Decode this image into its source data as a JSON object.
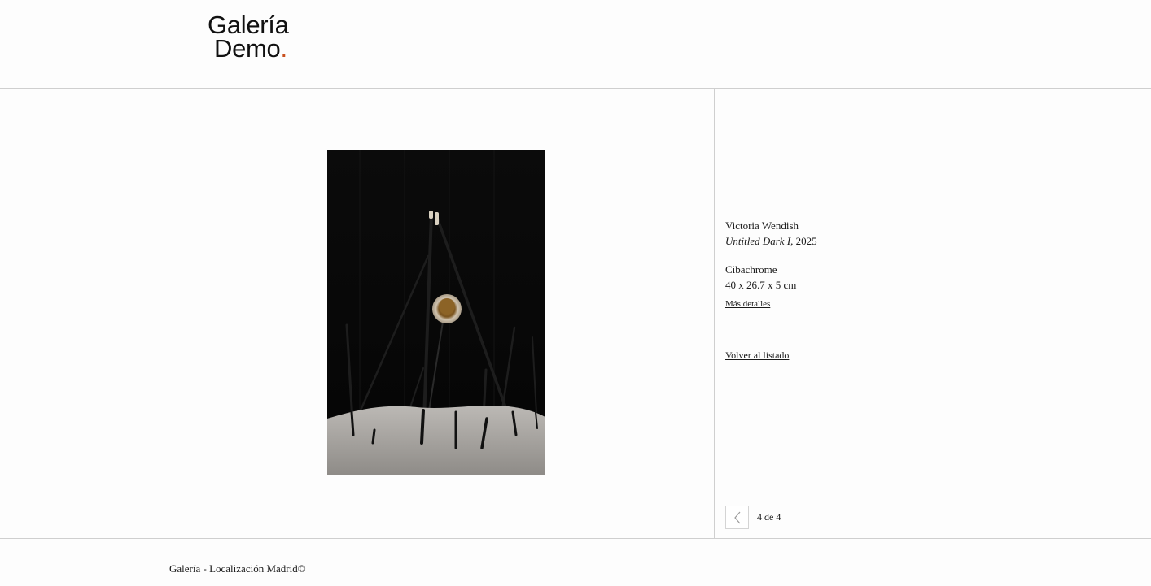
{
  "logo": {
    "line1": "Galería",
    "line2": "Demo",
    "dot": ".",
    "accent_color": "#c9501e"
  },
  "artwork": {
    "artist": "Victoria Wendish",
    "title": "Untitled Dark I",
    "year_text": ", 2025",
    "medium": "Cibachrome",
    "dimensions": "40 x 26.7 x 5 cm",
    "more_details_label": "Más detalles",
    "image_alt": "Untitled Dark I"
  },
  "nav": {
    "back_label": "Volver al listado",
    "counter": "4 de 4",
    "prev_icon": "chevron-left-icon"
  },
  "footer": {
    "text": "Galería - Localización Madrid©"
  }
}
